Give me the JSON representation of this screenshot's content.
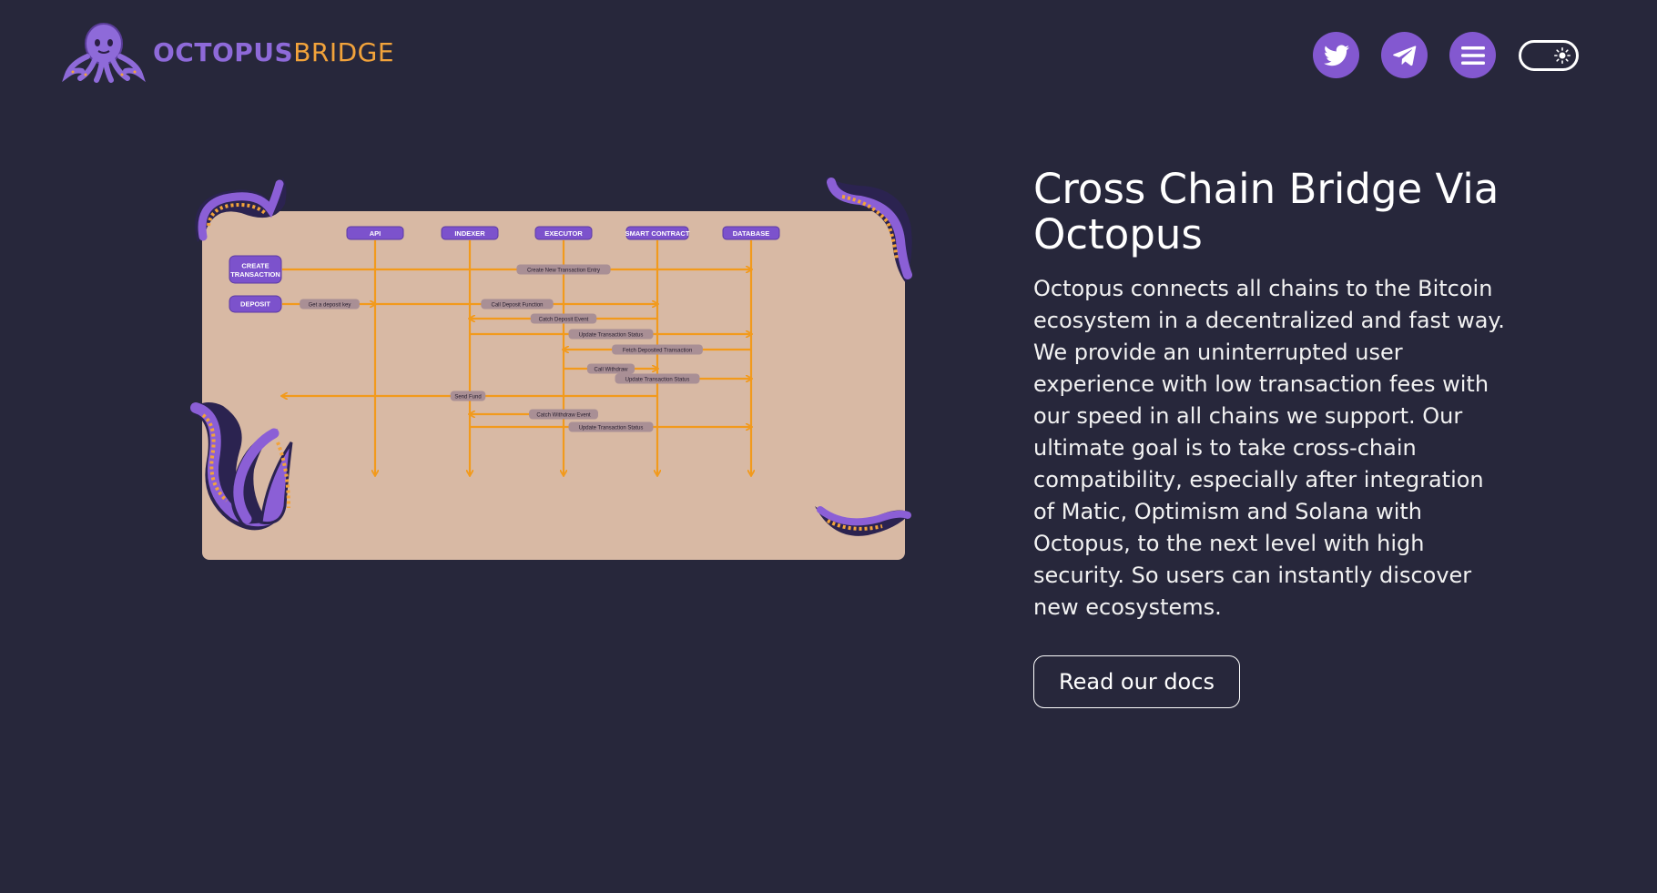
{
  "header": {
    "brand_part1": "OCTOPUS",
    "brand_part2": "BRIDGE",
    "icons": [
      "twitter-icon",
      "telegram-icon",
      "menu-icon",
      "sun-icon"
    ]
  },
  "diagram": {
    "lanes": [
      "API",
      "INDEXER",
      "EXECUTOR",
      "SMART CONTRACT",
      "DATABASE"
    ],
    "actions": [
      "CREATE TRANSACTION",
      "DEPOSIT"
    ],
    "messages": [
      "Create New Transaction Entry",
      "Get a deposit key",
      "Call Deposit Function",
      "Catch Deposit Event",
      "Update Transaction Status",
      "Fetch Deposited Transaction",
      "Call Withdraw",
      "Update Transaction Status",
      "Send Fund",
      "Catch Withdraw Event",
      "Update Transaction Status"
    ]
  },
  "main": {
    "title": "Cross Chain Bridge Via Octopus",
    "description": "Octopus connects all chains to the Bitcoin ecosystem in a decentralized and fast way. We provide an uninterrupted user experience with low transaction fees with our speed in all chains we support. Our ultimate goal is to take cross-chain compatibility, especially after integration of Matic, Optimism and Solana with Octopus, to the next level with high security. So users can instantly discover new ecosystems.",
    "docs_button": "Read our docs"
  },
  "colors": {
    "background": "#27273b",
    "accent_purple": "#8358d0",
    "accent_orange": "#f2a33b",
    "board": "#d8b9a4"
  }
}
